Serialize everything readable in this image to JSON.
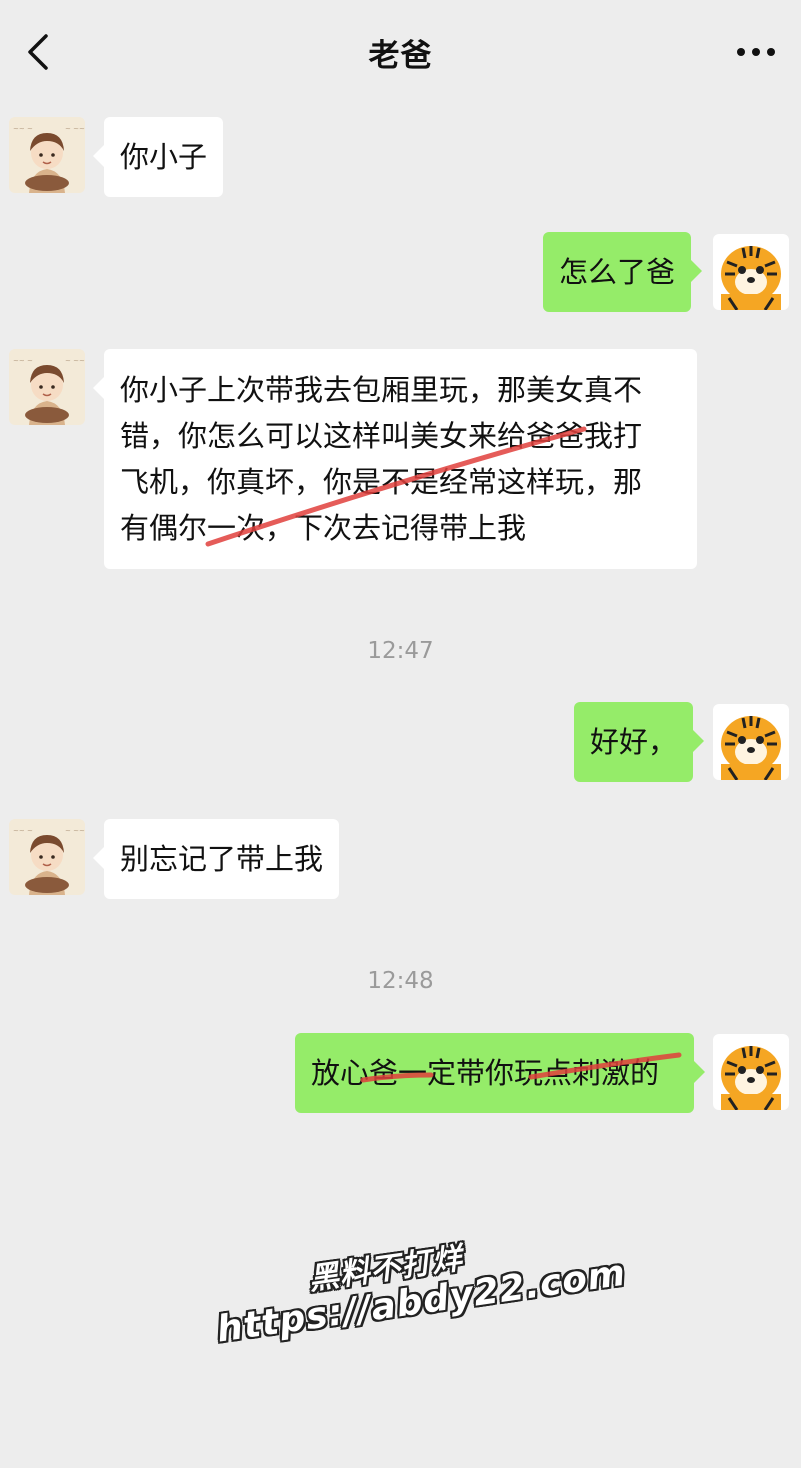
{
  "header": {
    "title": "老爸",
    "back_icon": "chevron-left-icon",
    "more_icon": "more-dots-icon"
  },
  "colors": {
    "background": "#ededed",
    "received_bubble": "#ffffff",
    "sent_bubble": "#95ec69",
    "strike": "#e0403c"
  },
  "messages": [
    {
      "side": "received",
      "text": "你小子"
    },
    {
      "side": "sent",
      "text": "怎么了爸"
    },
    {
      "side": "received",
      "lines": [
        "你小子上次带我去包厢里玩，那美女真不",
        "错，你怎么可以这样叫美女来给爸爸我打",
        "飞机，你真坏，你是不是经常这样玩，那",
        "有偶尔一次，下次去记得带上我"
      ]
    },
    {
      "side": "timestamp",
      "text": "12:47"
    },
    {
      "side": "sent",
      "text": "好好，"
    },
    {
      "side": "received",
      "text": "别忘记了带上我"
    },
    {
      "side": "timestamp",
      "text": "12:48"
    },
    {
      "side": "sent",
      "text": "放心爸一定带你玩点刺激的"
    }
  ],
  "watermark": {
    "line1": "黑料不打烊",
    "line2": "https://abdy22.com"
  }
}
